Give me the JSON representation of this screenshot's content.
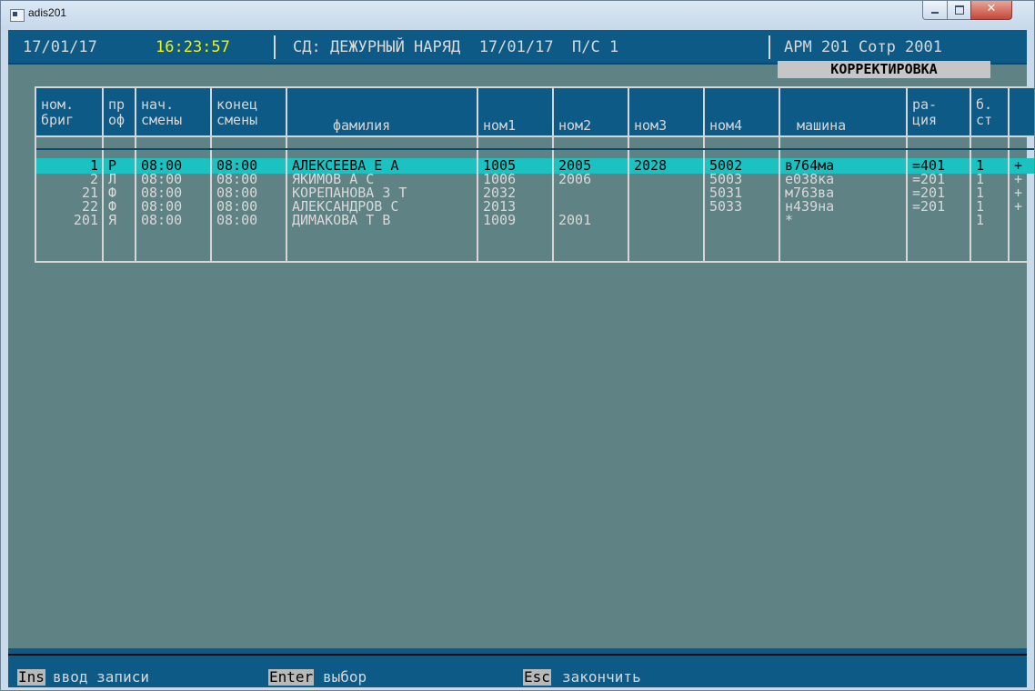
{
  "window": {
    "title": "adis201"
  },
  "header": {
    "date": "17/01/17",
    "time": "16:23:57",
    "center": "СД: ДЕЖУРНЫЙ НАРЯД  17/01/17  П/С 1",
    "right": "АРМ 201 Сотр 2001",
    "mode": "КОРРЕКТИРОВКА"
  },
  "table": {
    "headers": [
      [
        "ном.",
        "бриг"
      ],
      [
        "пр",
        "оф"
      ],
      [
        "нач.",
        "смены"
      ],
      [
        "конец",
        "смены"
      ],
      [
        "",
        "фамилия"
      ],
      [
        "",
        "ном1"
      ],
      [
        "",
        "ном2"
      ],
      [
        "",
        "ном3"
      ],
      [
        "",
        "ном4"
      ],
      [
        "",
        "машина"
      ],
      [
        "ра-",
        "ция"
      ],
      [
        "б.",
        "ст"
      ]
    ],
    "rows": [
      {
        "brig": "1",
        "prof": "Р",
        "start": "08:00",
        "end": "08:00",
        "name": "АЛЕКСЕЕВА Е А",
        "n1": "1005",
        "n2": "2005",
        "n3": "2028",
        "n4": "5002",
        "car": "в764ма",
        "radio": "=401",
        "bst": "1",
        "mark": "+"
      },
      {
        "brig": "2",
        "prof": "Л",
        "start": "08:00",
        "end": "08:00",
        "name": "ЯКИМОВ А С",
        "n1": "1006",
        "n2": "2006",
        "n3": "",
        "n4": "5003",
        "car": "е038ка",
        "radio": "=201",
        "bst": "1",
        "mark": "+"
      },
      {
        "brig": "21",
        "prof": "Ф",
        "start": "08:00",
        "end": "08:00",
        "name": "КОРЕПАНОВА З Т",
        "n1": "2032",
        "n2": "",
        "n3": "",
        "n4": "5031",
        "car": "м763ва",
        "radio": "=201",
        "bst": "1",
        "mark": "+"
      },
      {
        "brig": "22",
        "prof": "Ф",
        "start": "08:00",
        "end": "08:00",
        "name": "АЛЕКСАНДРОВ С",
        "n1": "2013",
        "n2": "",
        "n3": "",
        "n4": "5033",
        "car": "н439на",
        "radio": "=201",
        "bst": "1",
        "mark": "+"
      },
      {
        "brig": "201",
        "prof": "Я",
        "start": "08:00",
        "end": "08:00",
        "name": "ДИМАКОВА Т В",
        "n1": "1009",
        "n2": "2001",
        "n3": "",
        "n4": "",
        "car": "*",
        "radio": "",
        "bst": "1",
        "mark": ""
      }
    ]
  },
  "footer": {
    "ins_key": "Ins",
    "ins_label": "ввод записи",
    "enter_key": "Enter",
    "enter_label": "выбор",
    "esc_key": "Esc",
    "esc_label": "закончить"
  },
  "colors": {
    "screen_bg": "#5f8384",
    "bar_blue": "#0d5a86",
    "selected_row": "#1cc2c2",
    "time_yellow": "#f4f400"
  }
}
